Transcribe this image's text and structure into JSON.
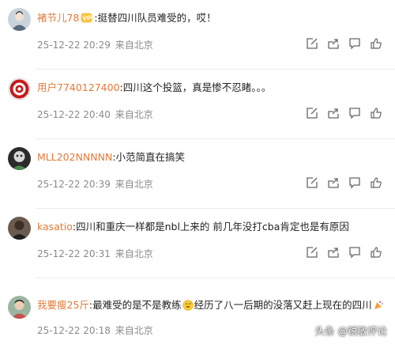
{
  "comments": [
    {
      "username": "褚节儿78",
      "username_color": "#e07b39",
      "badge": "vip-badge-icon",
      "text": ":挺替四川队员难受的，哎！",
      "date": "25-12-22 20:29",
      "location": "来自北京"
    },
    {
      "username": "用户7740127400",
      "username_color": "#e07b39",
      "text": ":四川这个投篮，真是惨不忍睹。。。",
      "date": "25-12-22 20:40",
      "location": "来自北京"
    },
    {
      "username": "MLL202NNNNN",
      "username_color": "#e07b39",
      "text": ":小范简直在搞笑",
      "date": "25-12-22 20:39",
      "location": "来自北京"
    },
    {
      "username": "kasatio",
      "username_color": "#e07b39",
      "text": ":四川和重庆一样都是nbl上来的 前几年没打cba肯定也是有原因",
      "date": "25-12-22 20:31",
      "location": "来自北京"
    },
    {
      "username": "我要瘦25斤",
      "username_color": "#e07b39",
      "text_part1": ":最难受的是不是教练",
      "text_part2": "经历了八一后期的没落又赶上现在的四川",
      "emoji1": "sweat-smile-emoji-icon",
      "emoji2": "celebration-emoji-icon",
      "date": "25-12-22 20:18",
      "location": "来自北京"
    }
  ],
  "watermark": "头条 @锐敏评论",
  "action_icons": [
    "edit-icon",
    "share-icon",
    "comment-icon",
    "like-icon"
  ]
}
